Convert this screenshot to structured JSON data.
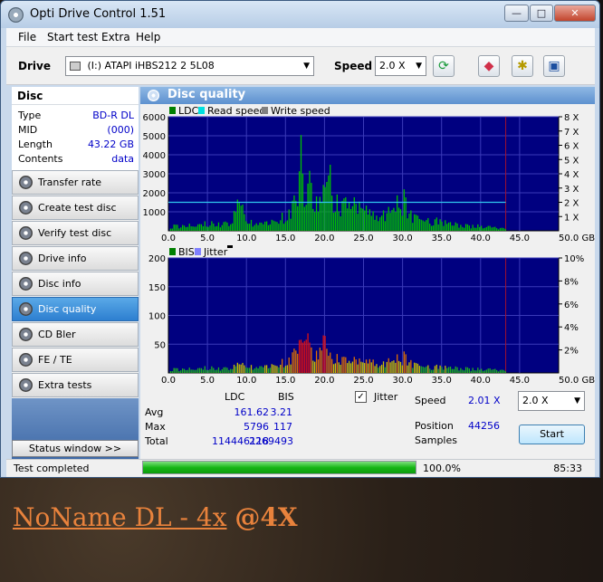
{
  "window": {
    "title": "Opti Drive Control 1.51",
    "minimize": "—",
    "maximize": "□",
    "close": "✕"
  },
  "menu": [
    "File",
    "Start test",
    "Extra",
    "Help"
  ],
  "toolbar": {
    "drive_label": "Drive",
    "drive_value": "(I:)   ATAPI iHBS212   2 5L08",
    "speed_label": "Speed",
    "speed_value": "2.0 X",
    "icons": [
      "refresh-icon",
      "eraser-icon",
      "chip-icon",
      "save-icon"
    ]
  },
  "disc": {
    "heading": "Disc",
    "rows": [
      {
        "key": "Type",
        "value": "BD-R DL"
      },
      {
        "key": "MID",
        "value": "(000)"
      },
      {
        "key": "Length",
        "value": "43.22 GB"
      },
      {
        "key": "Contents",
        "value": "data"
      }
    ]
  },
  "nav": [
    {
      "label": "Transfer rate",
      "active": false
    },
    {
      "label": "Create test disc",
      "active": false
    },
    {
      "label": "Verify test disc",
      "active": false
    },
    {
      "label": "Drive info",
      "active": false
    },
    {
      "label": "Disc info",
      "active": false
    },
    {
      "label": "Disc quality",
      "active": true
    },
    {
      "label": "CD Bler",
      "active": false
    },
    {
      "label": "FE / TE",
      "active": false
    },
    {
      "label": "Extra tests",
      "active": false
    }
  ],
  "status_window_button": "Status window >>",
  "panel_title": "Disc quality",
  "chart_data": [
    {
      "type": "area",
      "legend": [
        "LDC",
        "Read speed",
        "Write speed"
      ],
      "legend_colors": [
        "#008000",
        "#00e0e0",
        "#808080"
      ],
      "x_ticks": [
        "0.0",
        "5.0",
        "10.0",
        "15.0",
        "20.0",
        "25.0",
        "30.0",
        "35.0",
        "40.0",
        "45.0",
        "50.0 GB"
      ],
      "y_ticks": [
        "1000",
        "2000",
        "3000",
        "4000",
        "5000",
        "6000"
      ],
      "y2_ticks": [
        "1 X",
        "2 X",
        "3 X",
        "4 X",
        "5 X",
        "6 X",
        "7 X",
        "8 X"
      ],
      "xlim": [
        0,
        50
      ],
      "ylim": [
        0,
        6000
      ],
      "y2lim": [
        0,
        8
      ],
      "end_marker_gb": 43.22,
      "read_speed_x": 2.0,
      "ldc_x": [
        0,
        2,
        4,
        6,
        8,
        9,
        10,
        12,
        14,
        15,
        16,
        16.8,
        17,
        17.3,
        18,
        19,
        20,
        20.5,
        21,
        22,
        23,
        24,
        25,
        26,
        27,
        28,
        29,
        30,
        30.5,
        31,
        32,
        34,
        36,
        38,
        40,
        42,
        43.2
      ],
      "ldc_y": [
        300,
        400,
        500,
        450,
        600,
        2000,
        650,
        500,
        700,
        1100,
        1800,
        4500,
        5800,
        2200,
        3000,
        1800,
        2500,
        5000,
        2200,
        1600,
        2000,
        1500,
        1400,
        1000,
        1300,
        1200,
        1700,
        2300,
        1600,
        1200,
        900,
        700,
        500,
        350,
        300,
        200,
        150
      ]
    },
    {
      "type": "area",
      "legend": [
        "BIS",
        "Jitter"
      ],
      "legend_colors": [
        "#008000",
        "#8080ff"
      ],
      "x_ticks": [
        "0.0",
        "5.0",
        "10.0",
        "15.0",
        "20.0",
        "25.0",
        "30.0",
        "35.0",
        "40.0",
        "45.0",
        "50.0 GB"
      ],
      "y_ticks": [
        "50",
        "100",
        "150",
        "200"
      ],
      "y2_ticks": [
        "2%",
        "4%",
        "6%",
        "8%",
        "10%"
      ],
      "xlim": [
        0,
        50
      ],
      "ylim": [
        0,
        200
      ],
      "y2lim": [
        0,
        10
      ],
      "end_marker_gb": 43.22,
      "bis_x": [
        0,
        2,
        4,
        6,
        8,
        9,
        10,
        12,
        14,
        15,
        16,
        16.5,
        17,
        17.5,
        18,
        19,
        20,
        20.5,
        21,
        22,
        23,
        24,
        25,
        26,
        27,
        28,
        29,
        30,
        31,
        32,
        34,
        36,
        38,
        40,
        42,
        43.2
      ],
      "bis_y": [
        8,
        10,
        12,
        10,
        12,
        20,
        15,
        14,
        18,
        28,
        40,
        90,
        55,
        117,
        50,
        40,
        70,
        45,
        35,
        30,
        28,
        25,
        22,
        24,
        22,
        25,
        30,
        38,
        25,
        18,
        14,
        12,
        10,
        8,
        7,
        5
      ]
    }
  ],
  "stats": {
    "col_headers": [
      "LDC",
      "BIS"
    ],
    "rows": [
      {
        "label": "Avg",
        "ldc": "161.62",
        "bis": "3.21"
      },
      {
        "label": "Max",
        "ldc": "5796",
        "bis": "117"
      },
      {
        "label": "Total",
        "ldc": "114446118",
        "bis": "2269493"
      }
    ],
    "jitter_label": "Jitter",
    "jitter_checked": true,
    "speed_label": "Speed",
    "speed_value": "2.01 X",
    "speed_select": "2.0 X",
    "position_label": "Position",
    "position_value": "44256",
    "samples_label": "Samples",
    "start_button": "Start"
  },
  "statusbar": {
    "text": "Test completed",
    "progress_percent": 100,
    "progress_text": "100.0%",
    "time": "85:33"
  },
  "caption": {
    "part1": "NoName DL - 4x",
    "part2": "@4X"
  }
}
